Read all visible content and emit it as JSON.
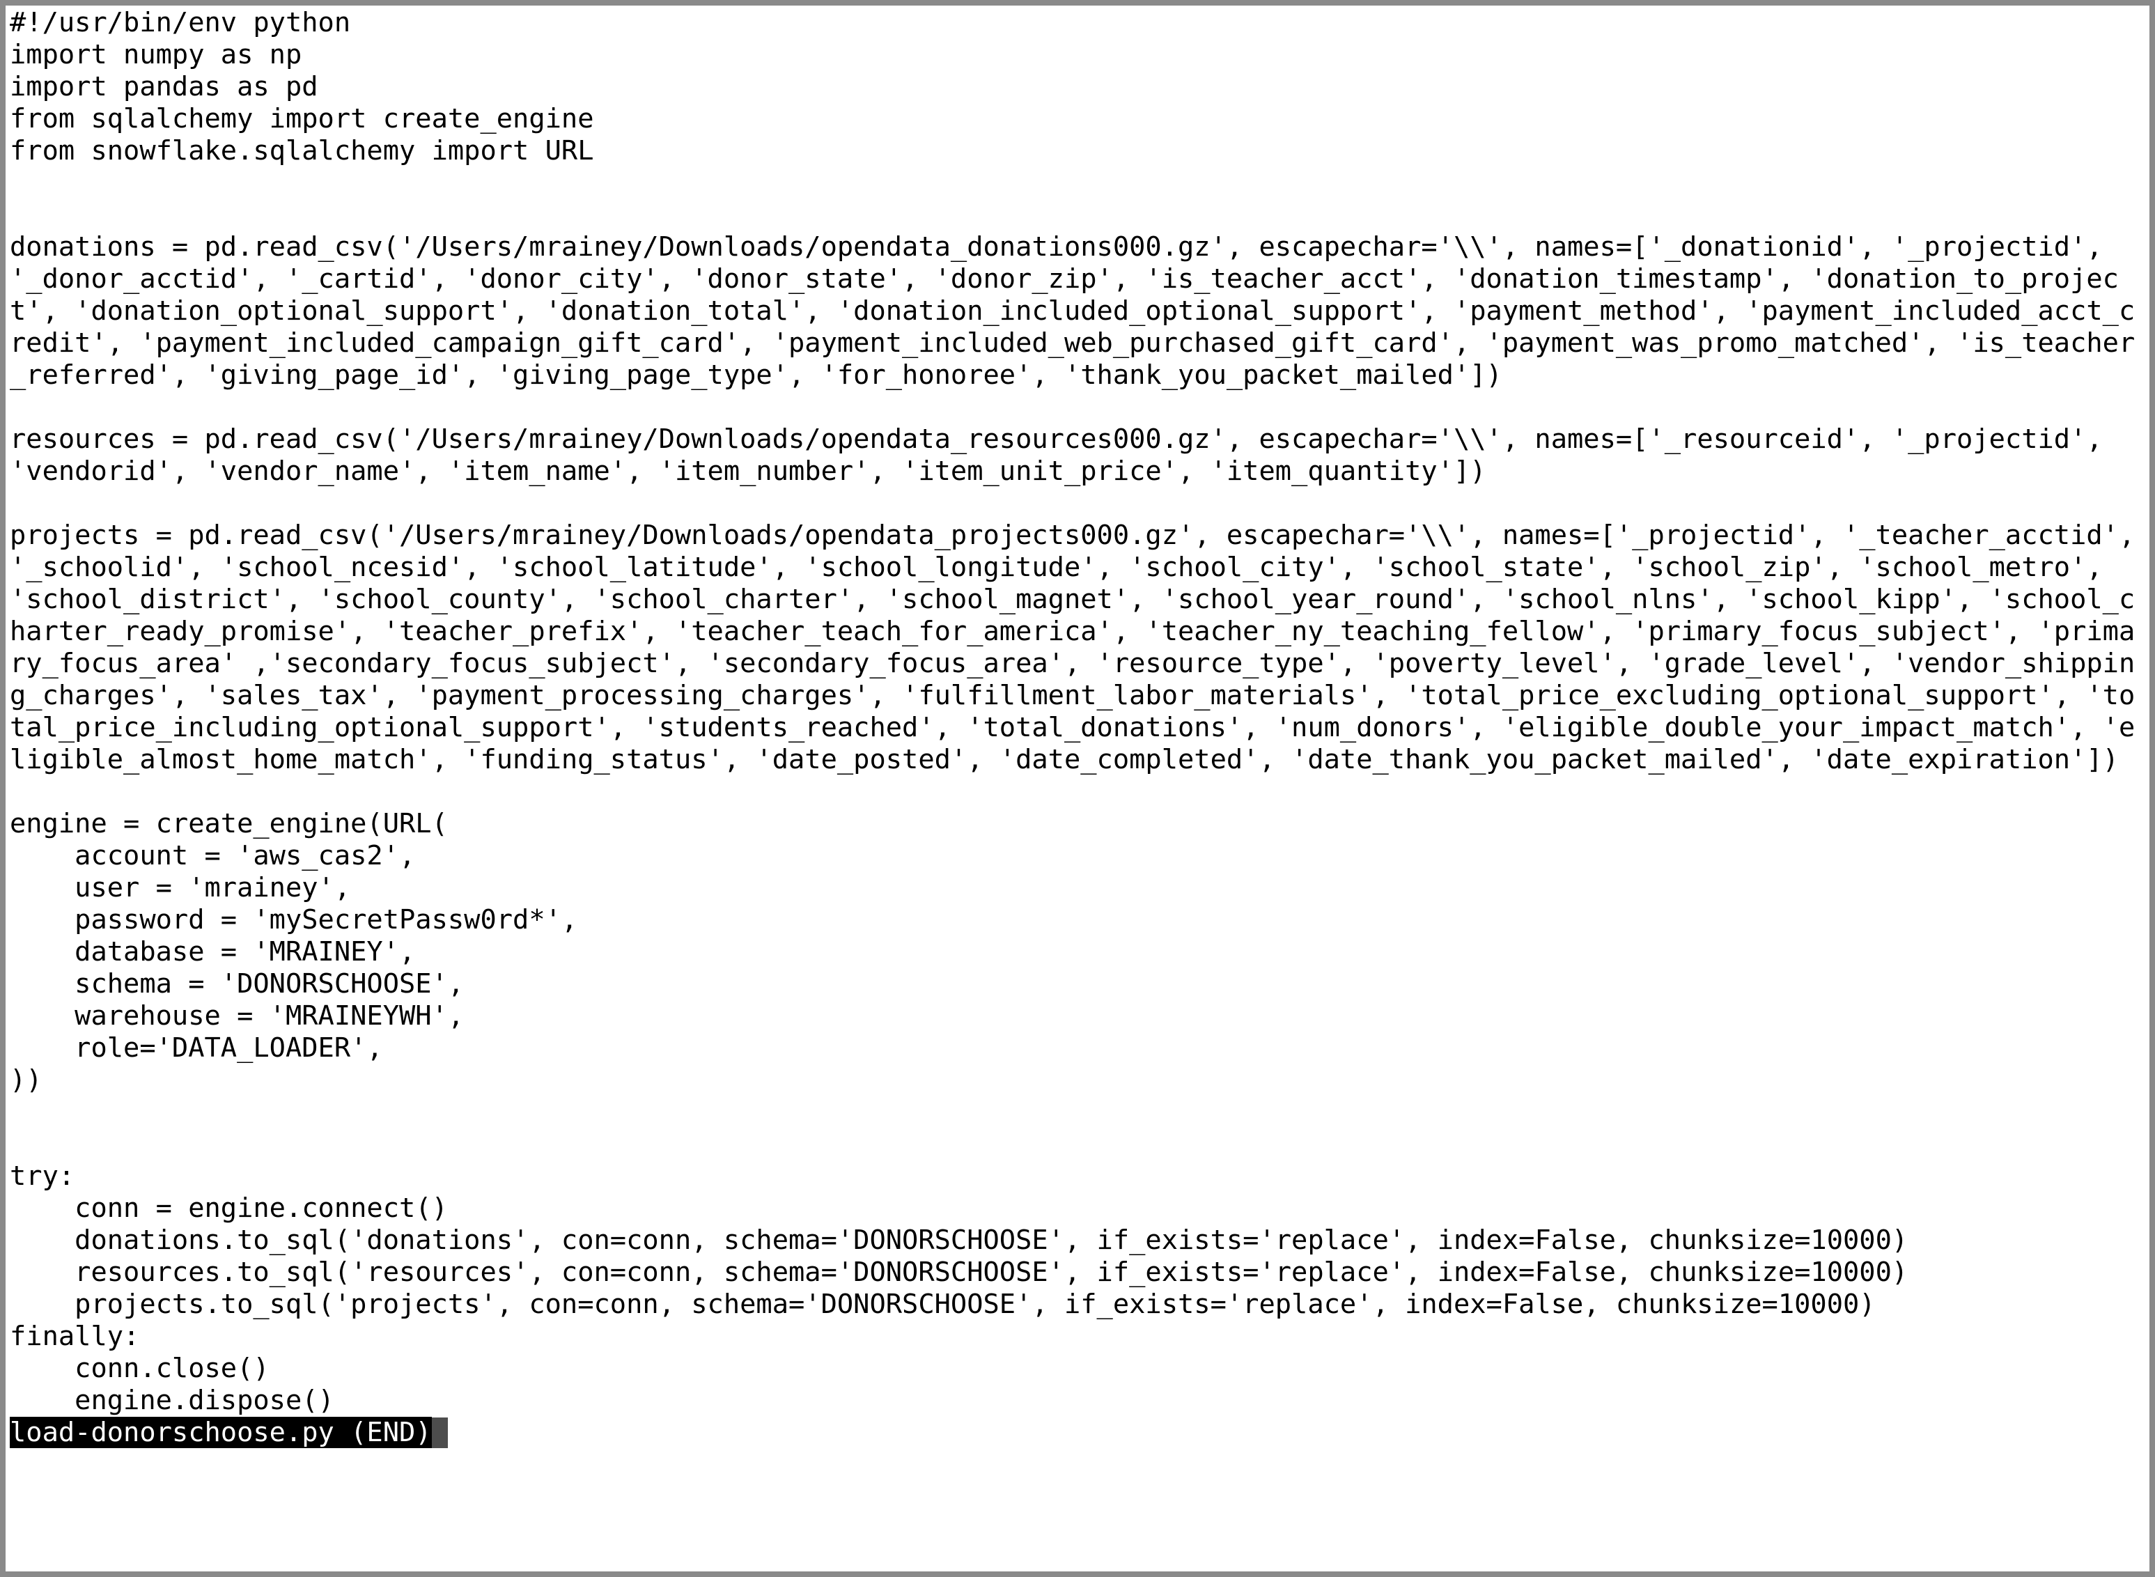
{
  "code_lines": [
    "#!/usr/bin/env python",
    "import numpy as np",
    "import pandas as pd",
    "from sqlalchemy import create_engine",
    "from snowflake.sqlalchemy import URL",
    "",
    "",
    "donations = pd.read_csv('/Users/mrainey/Downloads/opendata_donations000.gz', escapechar='\\\\', names=['_donationid', '_projectid', '_donor_acctid', '_cartid', 'donor_city', 'donor_state', 'donor_zip', 'is_teacher_acct', 'donation_timestamp', 'donation_to_project', 'donation_optional_support', 'donation_total', 'donation_included_optional_support', 'payment_method', 'payment_included_acct_credit', 'payment_included_campaign_gift_card', 'payment_included_web_purchased_gift_card', 'payment_was_promo_matched', 'is_teacher_referred', 'giving_page_id', 'giving_page_type', 'for_honoree', 'thank_you_packet_mailed'])",
    "",
    "resources = pd.read_csv('/Users/mrainey/Downloads/opendata_resources000.gz', escapechar='\\\\', names=['_resourceid', '_projectid', 'vendorid', 'vendor_name', 'item_name', 'item_number', 'item_unit_price', 'item_quantity'])",
    "",
    "projects = pd.read_csv('/Users/mrainey/Downloads/opendata_projects000.gz', escapechar='\\\\', names=['_projectid', '_teacher_acctid', '_schoolid', 'school_ncesid', 'school_latitude', 'school_longitude', 'school_city', 'school_state', 'school_zip', 'school_metro', 'school_district', 'school_county', 'school_charter', 'school_magnet', 'school_year_round', 'school_nlns', 'school_kipp', 'school_charter_ready_promise', 'teacher_prefix', 'teacher_teach_for_america', 'teacher_ny_teaching_fellow', 'primary_focus_subject', 'primary_focus_area' ,'secondary_focus_subject', 'secondary_focus_area', 'resource_type', 'poverty_level', 'grade_level', 'vendor_shipping_charges', 'sales_tax', 'payment_processing_charges', 'fulfillment_labor_materials', 'total_price_excluding_optional_support', 'total_price_including_optional_support', 'students_reached', 'total_donations', 'num_donors', 'eligible_double_your_impact_match', 'eligible_almost_home_match', 'funding_status', 'date_posted', 'date_completed', 'date_thank_you_packet_mailed', 'date_expiration'])",
    "",
    "engine = create_engine(URL(",
    "    account = 'aws_cas2',",
    "    user = 'mrainey',",
    "    password = 'mySecretPassw0rd*',",
    "    database = 'MRAINEY',",
    "    schema = 'DONORSCHOOSE',",
    "    warehouse = 'MRAINEYWH',",
    "    role='DATA_LOADER',",
    "))",
    "",
    "",
    "try:",
    "    conn = engine.connect()",
    "    donations.to_sql('donations', con=conn, schema='DONORSCHOOSE', if_exists='replace', index=False, chunksize=10000)",
    "    resources.to_sql('resources', con=conn, schema='DONORSCHOOSE', if_exists='replace', index=False, chunksize=10000)",
    "    projects.to_sql('projects', con=conn, schema='DONORSCHOOSE', if_exists='replace', index=False, chunksize=10000)",
    "finally:",
    "    conn.close()",
    "    engine.dispose()"
  ],
  "status": {
    "filename": "load-donorschoose.py",
    "marker": "(END)"
  }
}
